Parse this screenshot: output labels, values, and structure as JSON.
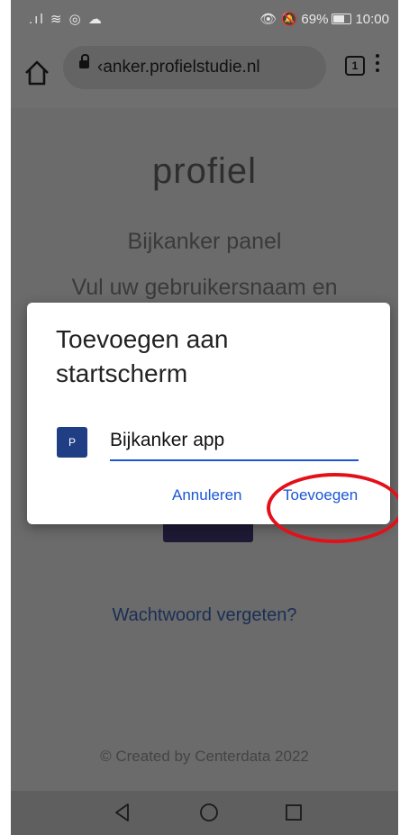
{
  "status_bar": {
    "battery": "69%",
    "time": "10:00"
  },
  "browser": {
    "url": "‹anker.profielstudie.nl",
    "tab_count": "1"
  },
  "page": {
    "logo": "profiel",
    "panel_title": "Bijkanker panel",
    "instruction": "Vul uw gebruikersnaam en",
    "forgot_link": "Wachtwoord vergeten?",
    "footer": "© Created by Centerdata 2022"
  },
  "dialog": {
    "title": "Toevoegen aan startscherm",
    "app_icon_letter": "P",
    "app_name_value": "Bijkanker app",
    "cancel_label": "Annuleren",
    "add_label": "Toevoegen"
  },
  "colors": {
    "accent": "#1a56d6",
    "highlight": "#e3101a",
    "app_icon": "#1f3e83"
  }
}
